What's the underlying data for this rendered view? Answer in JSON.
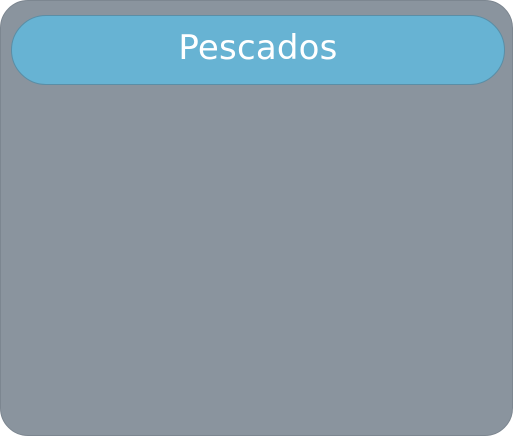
{
  "category_button": {
    "label": "Pescados"
  },
  "colors": {
    "panel_background": "#8a949e",
    "button_background": "#67b3d3",
    "button_text": "#ffffff"
  }
}
